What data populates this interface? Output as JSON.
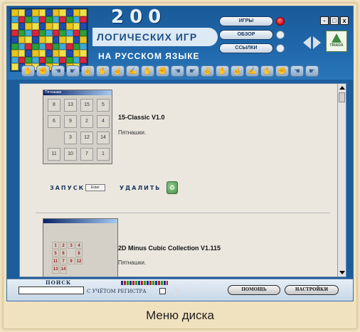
{
  "header": {
    "number": "200",
    "title": "ЛОГИЧЕСКИХ ИГР",
    "subtitle": "НА РУССКОМ ЯЗЫКЕ",
    "logo_text": "TRIADA"
  },
  "nav": [
    {
      "label": "ИГРЫ",
      "active": true
    },
    {
      "label": "ОБЗОР",
      "active": false
    },
    {
      "label": "ССЫЛКИ",
      "active": false
    }
  ],
  "window_controls": [
    "-",
    "□",
    "x"
  ],
  "games": [
    {
      "window_title": "Пятнашки",
      "tiles": [
        "8",
        "13",
        "15",
        "5",
        "6",
        "9",
        "2",
        "4",
        "",
        "3",
        "12",
        "14",
        "11",
        "10",
        "7",
        "1"
      ],
      "name": "15-Classic V1.0",
      "description": "Пятнашки.",
      "launch_label": "ЗАПУСК",
      "enter_key_label": "Enter",
      "delete_label": "УДАЛИТЬ"
    },
    {
      "board": [
        "1",
        "2",
        "3",
        "4",
        "5",
        "6",
        "",
        "8",
        "11",
        "7",
        "9",
        "12",
        "13",
        "14"
      ],
      "name": "2D Minus Cubic Collection V1.115",
      "description": "Пятнашки."
    }
  ],
  "footer": {
    "search_label": "ПОИСК",
    "search_value": "",
    "case_label": "С УЧЁТОМ РЕГИСТРА",
    "help_label": "ПОМОЩЬ",
    "settings_label": "НАСТРОЙКИ"
  },
  "caption": "Меню диска"
}
